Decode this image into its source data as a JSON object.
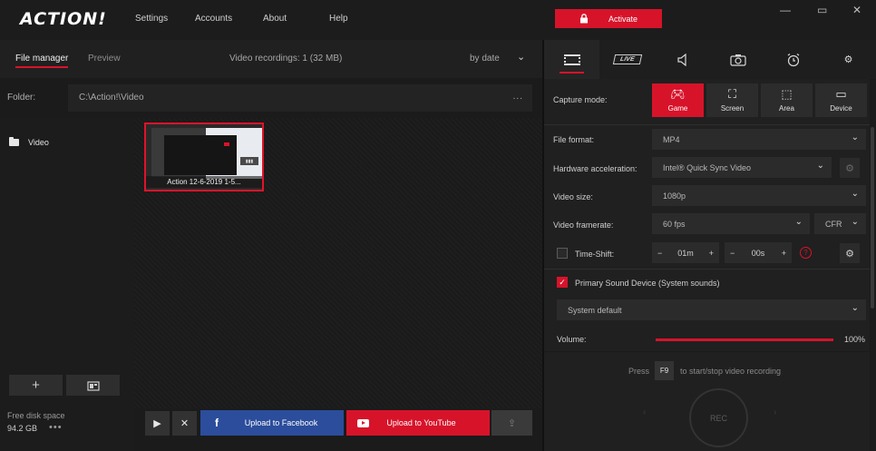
{
  "app": {
    "logo": "ACTION!",
    "menu": [
      "Settings",
      "Accounts",
      "About",
      "Help"
    ],
    "activate_label": "Activate",
    "window_controls": {
      "minimize": "—",
      "restore": "▭",
      "close": "✕"
    }
  },
  "left": {
    "tabs": [
      "File manager",
      "Preview"
    ],
    "recordings_info": "Video recordings: 1 (32 MB)",
    "sort": "by date",
    "folder_label": "Folder:",
    "folder_path": "C:\\Action!\\Video",
    "folder_more": "...",
    "tree_item": "Video",
    "add_label": "+",
    "disk_label": "Free disk space",
    "disk_value": "94.2 GB",
    "disk_more": "•••",
    "thumbnail": {
      "title": "Action 12-6-2019 1-5..."
    },
    "actions": {
      "facebook": "Upload to Facebook",
      "youtube": "Upload to YouTube"
    }
  },
  "right": {
    "capture": {
      "label": "Capture mode:",
      "modes": [
        "Game",
        "Screen",
        "Area",
        "Device"
      ]
    },
    "file_format": {
      "label": "File format:",
      "value": "MP4"
    },
    "hw_accel": {
      "label": "Hardware acceleration:",
      "value": "Intel® Quick Sync Video"
    },
    "video_size": {
      "label": "Video size:",
      "value": "1080p"
    },
    "framerate": {
      "label": "Video framerate:",
      "value": "60 fps",
      "mode": "CFR"
    },
    "timeshift": {
      "label": "Time-Shift:",
      "minutes": "01m",
      "seconds": "00s",
      "minus": "−",
      "plus": "+",
      "help": "?"
    },
    "sound": {
      "label": "Primary Sound Device (System sounds)",
      "device": "System default",
      "volume_label": "Volume:",
      "volume_value": "100%",
      "volume_level": 1.0
    },
    "hint": {
      "press": "Press",
      "key": "F9",
      "rest": "to start/stop video recording"
    },
    "rec_label": "REC"
  }
}
